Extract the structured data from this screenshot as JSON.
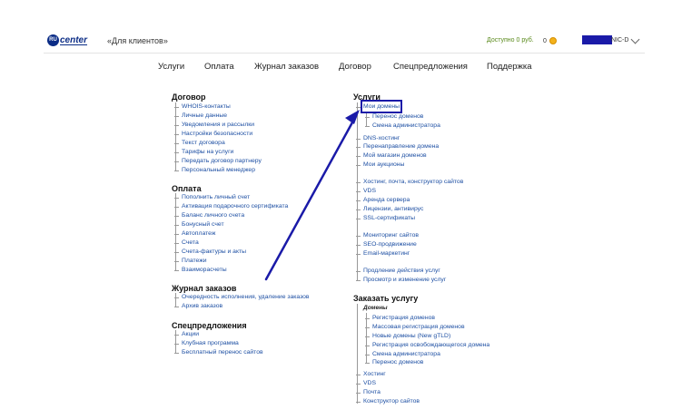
{
  "header": {
    "logo_text": "center",
    "logo_badge": "RU",
    "site_title": "«Для клиентов»",
    "balance": "Доступно 0 руб.",
    "bonus": "0",
    "user": "NIC-D"
  },
  "nav": [
    "Услуги",
    "Оплата",
    "Журнал заказов",
    "Договор",
    "Спецпредложения",
    "Поддержка"
  ],
  "left": {
    "contract": {
      "title": "Договор",
      "items": [
        "WHOIS-контакты",
        "Личные данные",
        "Уведомления и рассылки",
        "Настройки безопасности",
        "Текст договора",
        "Тарифы на услуги",
        "Передать договор партнеру",
        "Персональный менеджер"
      ]
    },
    "payment": {
      "title": "Оплата",
      "items": [
        "Пополнить личный счет",
        "Активация подарочного сертификата",
        "Баланс личного счета",
        "Бонусный счет",
        "Автоплатеж",
        "Счета",
        "Счета-фактуры и акты",
        "Платежи",
        "Взаиморасчеты"
      ]
    },
    "orders": {
      "title": "Журнал заказов",
      "items": [
        "Очередность исполнения, удаление заказов",
        "Архив заказов"
      ]
    },
    "offers": {
      "title": "Спецпредложения",
      "items": [
        "Акции",
        "Клубная программа",
        "Бесплатный перенос сайтов"
      ]
    }
  },
  "right": {
    "services": {
      "title": "Услуги",
      "my_domains": "Мои домены",
      "domain_sub": [
        "Перенос доменов",
        "Смена администратора"
      ],
      "group1": [
        "DNS-хостинг",
        "Перенаправление домена",
        "Мой магазин доменов",
        "Мои аукционы"
      ],
      "group2": [
        "Хостинг, почта, конструктор сайтов",
        "VDS",
        "Аренда сервера",
        "Лицензии, антивирус",
        "SSL-сертификаты"
      ],
      "group3": [
        "Мониторинг сайтов",
        "SEO-продвижение",
        "Email-маркетинг"
      ],
      "group4": [
        "Продление действия услуг",
        "Просмотр и изменение услуг"
      ]
    },
    "order": {
      "title": "Заказать услугу",
      "domains_label": "Домены",
      "domains": [
        "Регистрация доменов",
        "Массовая регистрация доменов",
        "Новые домены (New gTLD)",
        "Регистрация освобождающегося домена",
        "Смена администратора",
        "Перенос доменов"
      ],
      "other": [
        "Хостинг",
        "VDS",
        "Почта",
        "Конструктор сайтов"
      ]
    }
  }
}
